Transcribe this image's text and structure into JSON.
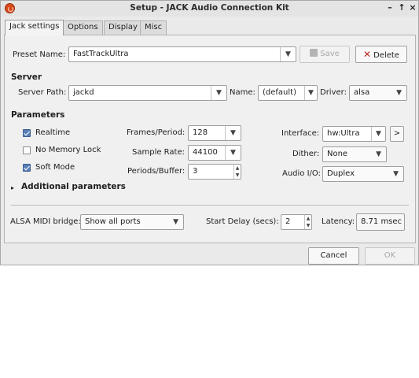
{
  "window": {
    "title": "Setup - JACK Audio Connection Kit",
    "buttons": {
      "minimize": "–",
      "maximize": "↑",
      "close": "×"
    }
  },
  "tabs": [
    {
      "label": "Jack settings",
      "active": true
    },
    {
      "label": "Options",
      "active": false
    },
    {
      "label": "Display",
      "active": false
    },
    {
      "label": "Misc",
      "active": false
    }
  ],
  "preset": {
    "label": "Preset Name:",
    "value": "FastTrackUltra",
    "save_label": "Save",
    "delete_label": "Delete"
  },
  "server": {
    "header": "Server",
    "path_label": "Server Path:",
    "path_value": "jackd",
    "name_label": "Name:",
    "name_value": "(default)",
    "driver_label": "Driver:",
    "driver_value": "alsa"
  },
  "parameters": {
    "header": "Parameters",
    "realtime": {
      "label": "Realtime",
      "checked": true
    },
    "no_memory_lock": {
      "label": "No Memory Lock",
      "checked": false
    },
    "soft_mode": {
      "label": "Soft Mode",
      "checked": true
    },
    "frames_label": "Frames/Period:",
    "frames_value": "128",
    "sample_rate_label": "Sample Rate:",
    "sample_rate_value": "44100",
    "periods_label": "Periods/Buffer:",
    "periods_value": "3",
    "interface_label": "Interface:",
    "interface_value": "hw:Ultra",
    "interface_more": ">",
    "dither_label": "Dither:",
    "dither_value": "None",
    "audio_io_label": "Audio I/O:",
    "audio_io_value": "Duplex",
    "additional_label": "Additional parameters",
    "additional_expander": "▸"
  },
  "bottom": {
    "midi_label": "ALSA MIDI bridge:",
    "midi_value": "Show all ports",
    "start_delay_label": "Start Delay (secs):",
    "start_delay_value": "2",
    "latency_label": "Latency:",
    "latency_value": "8.71 msec"
  },
  "dialog": {
    "cancel_label": "Cancel",
    "ok_label": "OK"
  },
  "colors": {
    "delete_icon": "#c0281e",
    "save_icon_disabled": "#a8a8a8",
    "checkbox_on": "#5a7fb6"
  }
}
